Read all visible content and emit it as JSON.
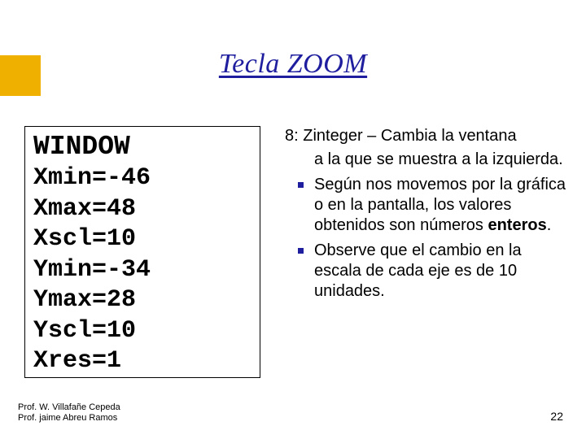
{
  "title": "Tecla ZOOM",
  "calculator_screen": {
    "header": "WINDOW",
    "lines": [
      "Xmin=-46",
      "Xmax=48",
      "Xscl=10",
      "Ymin=-34",
      "Ymax=28",
      "Yscl=10",
      "Xres=1"
    ]
  },
  "body": {
    "lead": "8: Zinteger – Cambia la ventana",
    "lead_cont": "a la que se muestra a la izquierda.",
    "bullets": [
      {
        "pre": "Según nos movemos por la gráfica o en la pantalla, los valores obtenidos son números ",
        "bold": "enteros",
        "post": "."
      },
      {
        "pre": "Observe que el cambio en la escala de cada eje es de 10 unidades.",
        "bold": "",
        "post": ""
      }
    ]
  },
  "footer": {
    "author1": "Prof. W. Villafañe Cepeda",
    "author2": "Prof. jaime Abreu Ramos",
    "page": "22"
  },
  "colors": {
    "accent": "#1e1e9e",
    "gold": "#f0b000"
  }
}
